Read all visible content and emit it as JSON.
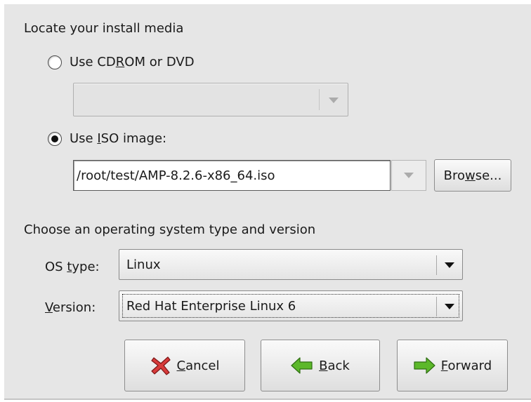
{
  "media": {
    "heading": "Locate your install media",
    "cdrom": {
      "label_pre": "Use CD",
      "label_u": "R",
      "label_post": "OM or DVD",
      "selected": false
    },
    "iso": {
      "label_pre": "Use ",
      "label_u": "I",
      "label_post": "SO image:",
      "selected": true
    },
    "iso_path": "/root/test/AMP-8.2.6-x86_64.iso",
    "browse": {
      "pre": "Bro",
      "u": "w",
      "post": "se..."
    }
  },
  "os": {
    "heading": "Choose an operating system type and version",
    "type_label": {
      "pre": "OS ",
      "u": "t",
      "post": "ype:"
    },
    "type_value": "Linux",
    "version_label": {
      "pre": "",
      "u": "V",
      "post": "ersion:"
    },
    "version_value": "Red Hat Enterprise Linux 6"
  },
  "actions": {
    "cancel": {
      "u": "C",
      "post": "ancel"
    },
    "back": {
      "u": "B",
      "post": "ack"
    },
    "forward": {
      "u": "F",
      "post": "orward"
    }
  },
  "colors": {
    "dialog_bg": "#e6e6e6",
    "cancel_icon": "#d83a3a",
    "arrow_icon": "#5cb82a"
  }
}
